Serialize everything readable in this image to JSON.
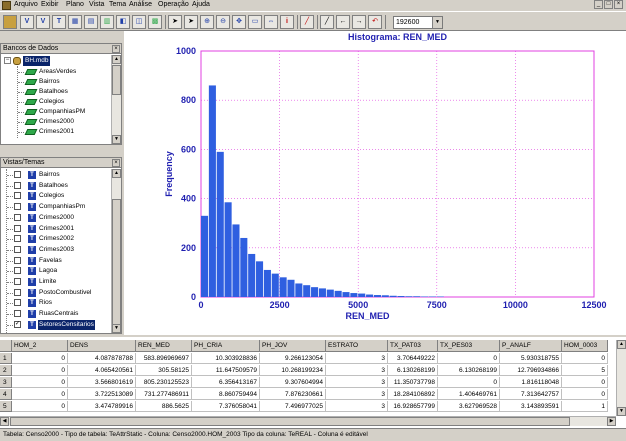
{
  "menu": [
    "Arquivo",
    "Exibir",
    "Plano",
    "Vista",
    "Tema",
    "Análise",
    "Operação",
    "Ajuda"
  ],
  "window_controls": [
    "_",
    "□",
    "×"
  ],
  "toolbar": {
    "scale_value": "192600"
  },
  "databases_panel": {
    "title": "Bancos de Dados",
    "db_name": "BH.mdb",
    "layers": [
      "AreasVerdes",
      "Bairros",
      "Batalhoes",
      "Colegios",
      "CompanhiasPM",
      "Crimes2000",
      "Crimes2001"
    ]
  },
  "views_panel": {
    "title": "Vistas/Temas",
    "themes": [
      "Bairros",
      "Batalhoes",
      "Colegios",
      "CompanhiasPm",
      "Crimes2000",
      "Crimes2001",
      "Crimes2002",
      "Crimes2003",
      "Favelas",
      "Lagoa",
      "Limite",
      "PostoCombustivel",
      "Rios",
      "RuasCentrais",
      "SetoresCensitarios"
    ],
    "checked_theme": "SetoresCensitarios"
  },
  "chart_data": {
    "type": "bar",
    "title": "Histograma: REN_MED",
    "xlabel": "REN_MED",
    "ylabel": "Frequency",
    "xlim": [
      0,
      12500
    ],
    "ylim": [
      0,
      1000
    ],
    "xticks": [
      0,
      2500,
      5000,
      7500,
      10000,
      12500
    ],
    "yticks": [
      0,
      200,
      400,
      600,
      800,
      1000
    ],
    "bin_width": 250,
    "bin_starts": [
      0,
      250,
      500,
      750,
      1000,
      1250,
      1500,
      1750,
      2000,
      2250,
      2500,
      2750,
      3000,
      3250,
      3500,
      3750,
      4000,
      4250,
      4500,
      4750,
      5000,
      5250,
      5500,
      5750,
      6000,
      6250,
      6500,
      6750,
      7000,
      7250,
      7500
    ],
    "values": [
      330,
      860,
      590,
      385,
      295,
      240,
      175,
      145,
      110,
      95,
      80,
      70,
      55,
      48,
      40,
      35,
      30,
      25,
      20,
      16,
      14,
      10,
      8,
      7,
      5,
      4,
      3,
      3,
      2,
      2,
      2
    ],
    "bar_color": "#2f5fe0",
    "grid": "dotted magenta",
    "grid_color": "#e040e0"
  },
  "table": {
    "columns": [
      "HOM_2",
      "DENS",
      "REN_MED",
      "PH_CRIA",
      "PH_JOV",
      "ESTRATO",
      "TX_PAT03",
      "TX_PES03",
      "P_ANALF",
      "HOM_0003"
    ],
    "rows": [
      [
        "1",
        "0",
        "4.087878788",
        "583.896969697",
        "10.303928836",
        "9.266123054",
        "3",
        "3.706449222",
        "0",
        "5.930318755",
        "0"
      ],
      [
        "2",
        "0",
        "4.065420561",
        "305.58125",
        "11.647509579",
        "10.268199234",
        "3",
        "6.130268199",
        "6.130268199",
        "12.796934866",
        "5"
      ],
      [
        "3",
        "0",
        "3.566801619",
        "805.230125523",
        "6.356413167",
        "9.307604994",
        "3",
        "11.350737798",
        "0",
        "1.816118048",
        "0"
      ],
      [
        "4",
        "0",
        "3.722513089",
        "731.277486911",
        "8.860759494",
        "7.876230661",
        "3",
        "18.284106892",
        "1.406469761",
        "7.313642757",
        "0"
      ],
      [
        "5",
        "0",
        "3.474789916",
        "886.5625",
        "7.376058041",
        "7.496977025",
        "3",
        "16.928657799",
        "3.627969528",
        "3.143893591",
        "1"
      ]
    ]
  },
  "status_text": "Tabela: Censo2000 - Tipo de tabela: TeAttrStatic - Coluna: Censo2000.HOM_2003  Tipo da coluna: TeREAL - Coluna é editável"
}
